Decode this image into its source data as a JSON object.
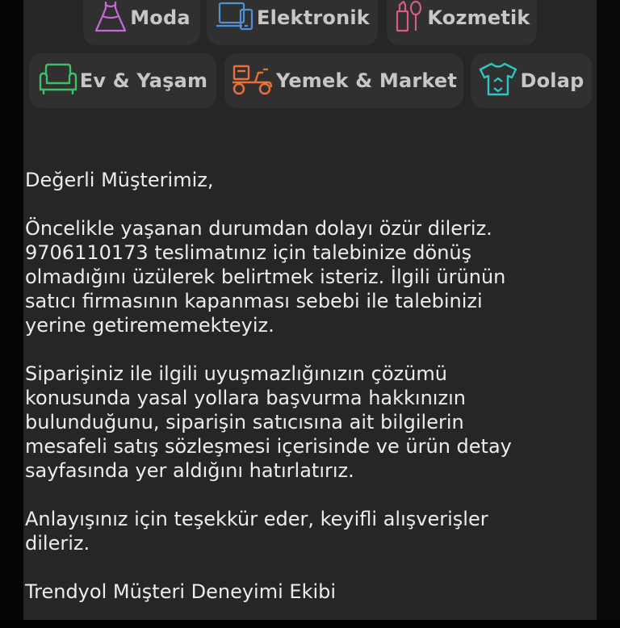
{
  "categories": {
    "row1": [
      {
        "label": "Moda",
        "icon": "dress-icon"
      },
      {
        "label": "Elektronik",
        "icon": "devices-icon"
      },
      {
        "label": "Kozmetik",
        "icon": "cosmetics-icon"
      }
    ],
    "row2": [
      {
        "label": "Ev & Yaşam",
        "icon": "armchair-icon"
      },
      {
        "label": "Yemek & Market",
        "icon": "delivery-scooter-icon"
      },
      {
        "label": "Dolap",
        "icon": "tshirt-recycle-icon"
      }
    ]
  },
  "message": {
    "greeting": "Değerli Müşterimiz,",
    "paragraph1": "Öncelikle yaşanan durumdan dolayı özür dileriz.\n9706110173 teslimatınız için talebinize dönüş\nolmadığını üzülerek belirtmek isteriz. İlgili ürünün\nsatıcı firmasının kapanması sebebi ile talebinizi\nyerine getirememekteyiz.",
    "paragraph2": "Siparişiniz ile ilgili uyuşmazlığınızın çözümü\nkonusunda yasal yollara başvurma hakkınızın\nbulunduğunu, siparişin satıcısına ait bilgilerin\nmesafeli satış sözleşmesi içerisinde ve ürün detay\nsayfasında yer aldığını hatırlatırız.",
    "paragraph3": "Anlayışınız için teşekkür eder, keyifli alışverişler\ndileriz.",
    "signature": "Trendyol Müşteri Deneyimi Ekibi"
  },
  "colors": {
    "panel_bg": "#262626",
    "chip_bg": "#303030",
    "chip_text": "#c7c7c7",
    "body_text": "#ececec",
    "moda_icon": "#c46bd6",
    "elektronik_icon": "#4f90d6",
    "kozmetik_icon": "#d85a8a",
    "ev_icon": "#3fbf6a",
    "yemek_icon": "#e8703a",
    "dolap_icon": "#2ec6c0"
  }
}
